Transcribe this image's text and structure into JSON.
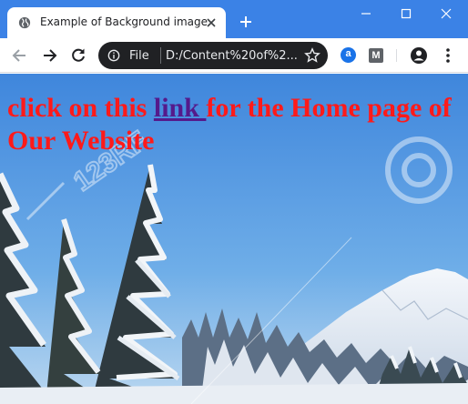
{
  "browser": {
    "tab": {
      "title": "Example of Background image"
    },
    "omnibox": {
      "scheme_label": "File",
      "url": "D:/Content%20of%2..."
    }
  },
  "extensions": [
    {
      "name": "a-extension-icon",
      "glyph": "a"
    },
    {
      "name": "m-extension-icon",
      "glyph": "M"
    }
  ],
  "page": {
    "text_before": "click on this ",
    "link_text": "link ",
    "text_after": "for the Home page of Our Website",
    "watermark": "123RF"
  },
  "colors": {
    "titlebar": "#3b82e6",
    "headline": "#ff1a1a",
    "link": "#551a8b"
  }
}
